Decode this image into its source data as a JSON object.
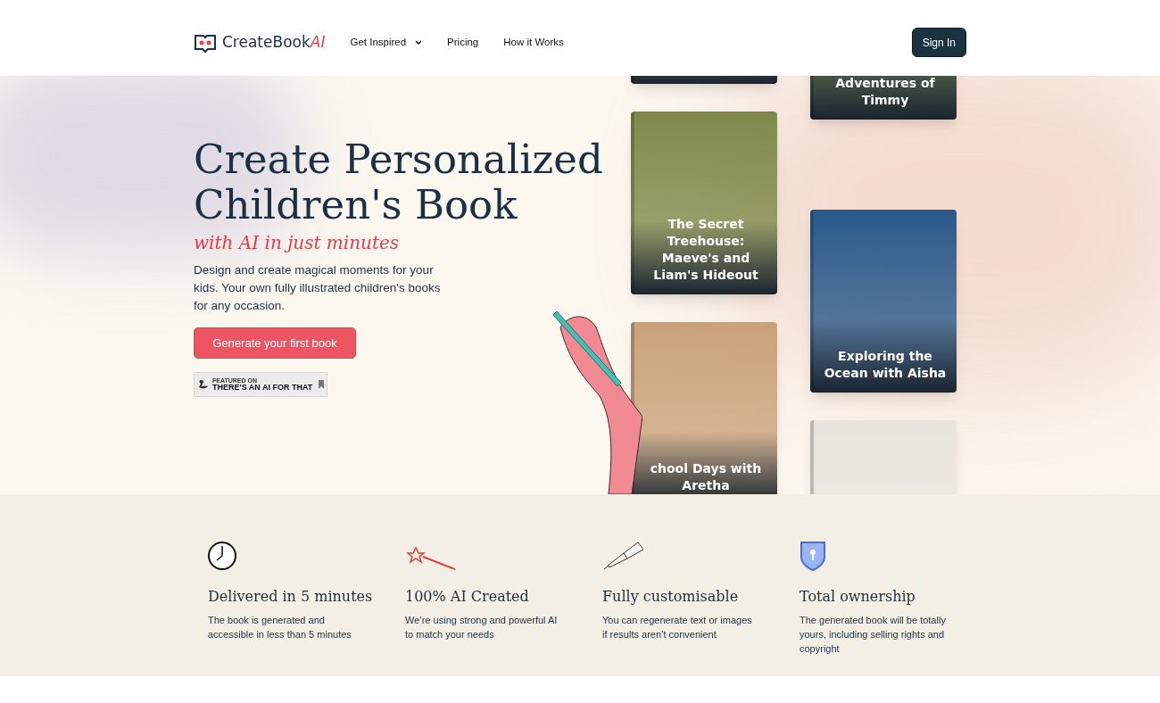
{
  "nav": {
    "logo": {
      "text": "CreateBook",
      "accent": "AI"
    },
    "links": [
      {
        "label": "Get Inspired",
        "dropdown": true
      },
      {
        "label": "Pricing",
        "dropdown": false
      },
      {
        "label": "How it Works",
        "dropdown": false
      }
    ],
    "sign_in": "Sign In"
  },
  "hero": {
    "title_lines": [
      "Create Personalized",
      "Children's Book"
    ],
    "tagline": "with AI in just minutes",
    "description": "Design and create magical moments for your kids. Your own  fully illustrated children's books for any occasion.",
    "cta": "Generate your first book",
    "badge": {
      "small": "FEATURED ON",
      "text": "THERE'S AN AI FOR THAT"
    }
  },
  "books": [
    {
      "title": "The Secret Treehouse: Maeve's and Liam's Hideout"
    },
    {
      "title": "chool Days with Aretha"
    },
    {
      "title": "Adventures of Timmy"
    },
    {
      "title": "Exploring the Ocean with Aisha"
    }
  ],
  "features": [
    {
      "title": "Delivered in 5 minutes",
      "text": "The book is generated and accessible in less than 5 minutes"
    },
    {
      "title": "100% AI Created",
      "text": "We’re using strong and powerful AI to match your needs"
    },
    {
      "title": "Fully customisable",
      "text": "You can regenerate text or images if results aren’t convenient"
    },
    {
      "title": "Total ownership",
      "text": "The generated book will be totally yours, including selling rights and copyright"
    }
  ]
}
